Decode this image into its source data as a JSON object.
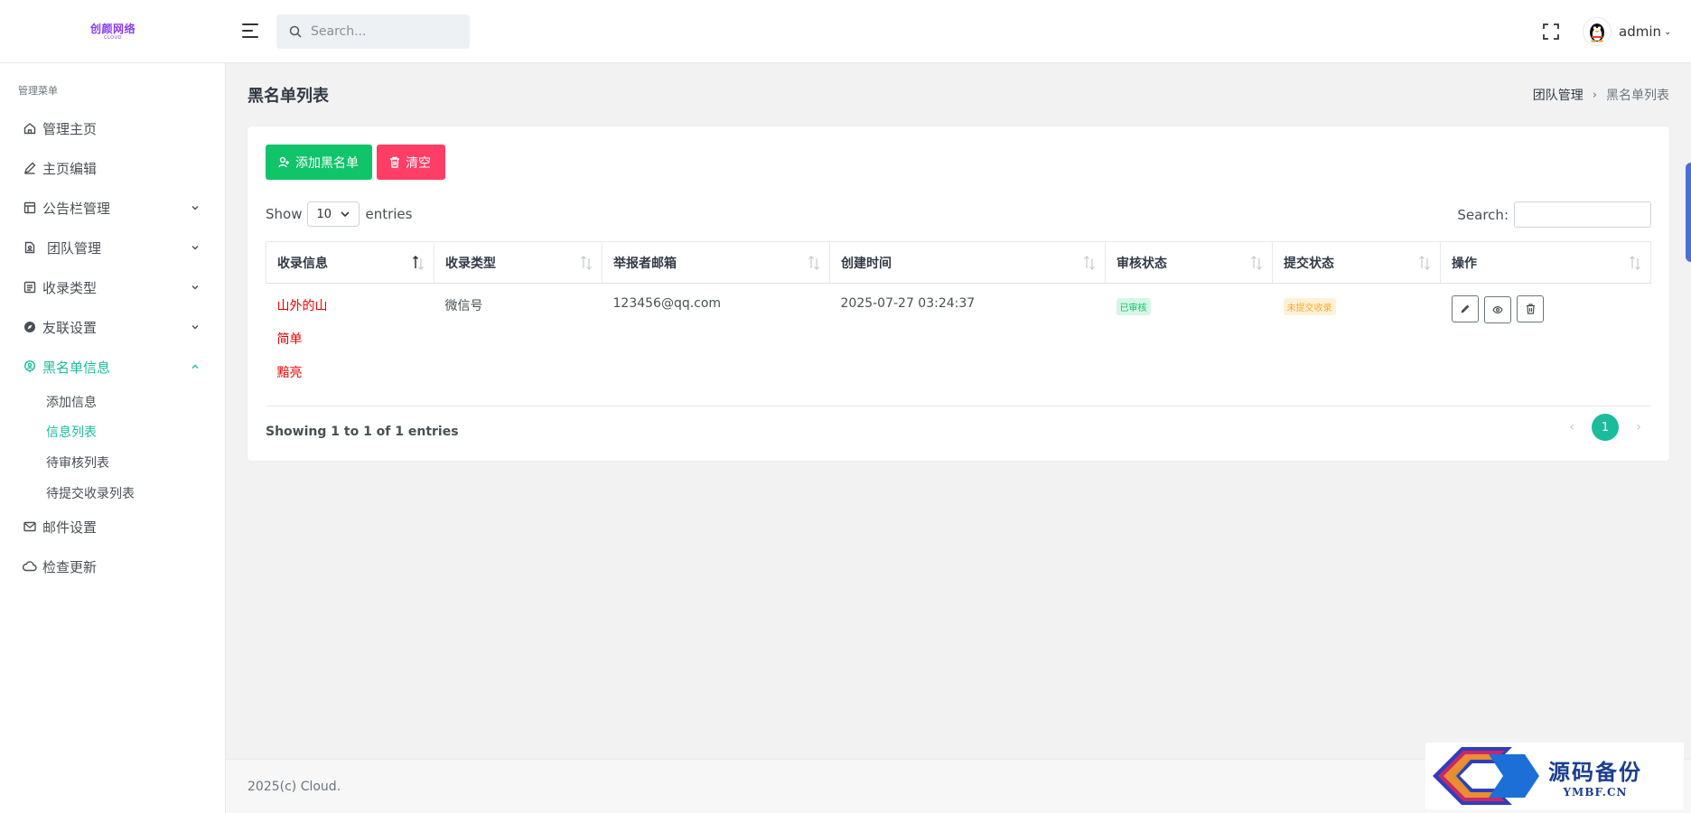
{
  "brand": {
    "logo_text": "创颜网络",
    "logo_sub": "CLOUD"
  },
  "header": {
    "search_placeholder": "Search...",
    "username": "admin"
  },
  "sidebar": {
    "menu_title": "管理菜单",
    "items": [
      {
        "label": "管理主页"
      },
      {
        "label": "主页编辑"
      },
      {
        "label": "公告栏管理"
      },
      {
        "label": "团队管理"
      },
      {
        "label": "收录类型"
      },
      {
        "label": "友联设置"
      },
      {
        "label": "黑名单信息"
      },
      {
        "label": "邮件设置"
      },
      {
        "label": "检查更新"
      }
    ],
    "sub_items": [
      {
        "label": "添加信息"
      },
      {
        "label": "信息列表"
      },
      {
        "label": "待审核列表"
      },
      {
        "label": "待提交收录列表"
      }
    ]
  },
  "page": {
    "title": "黑名单列表",
    "breadcrumb": {
      "parent": "团队管理",
      "current": "黑名单列表"
    }
  },
  "toolbar": {
    "add_label": "添加黑名单",
    "clear_label": "清空"
  },
  "table_controls": {
    "show_label": "Show",
    "length_value": "10",
    "entries_label": "entries",
    "search_label": "Search:"
  },
  "table": {
    "headers": [
      "收录信息",
      "收录类型",
      "举报者邮箱",
      "创建时间",
      "审核状态",
      "提交状态",
      "操作"
    ],
    "rows": [
      {
        "info_lines": [
          "山外的山",
          "简单",
          "黯亮"
        ],
        "type": "微信号",
        "email": "123456@qq.com",
        "created": "2025-07-27 03:24:37",
        "review_status": "已审核",
        "submit_status": "未提交收录"
      }
    ]
  },
  "pagination": {
    "info": "Showing 1 to 1 of 1 entries",
    "current_page": "1",
    "prev": "‹",
    "next": "›"
  },
  "footer": {
    "text": "2025(c) Cloud."
  },
  "watermark": {
    "char": "码",
    "title": "源码备份",
    "url": "YMBF.CN"
  },
  "colors": {
    "accent": "#1abc9c",
    "success": "#10c469",
    "danger": "#ff3e66",
    "warning": "#f9a825",
    "info_text": "#e00000"
  }
}
